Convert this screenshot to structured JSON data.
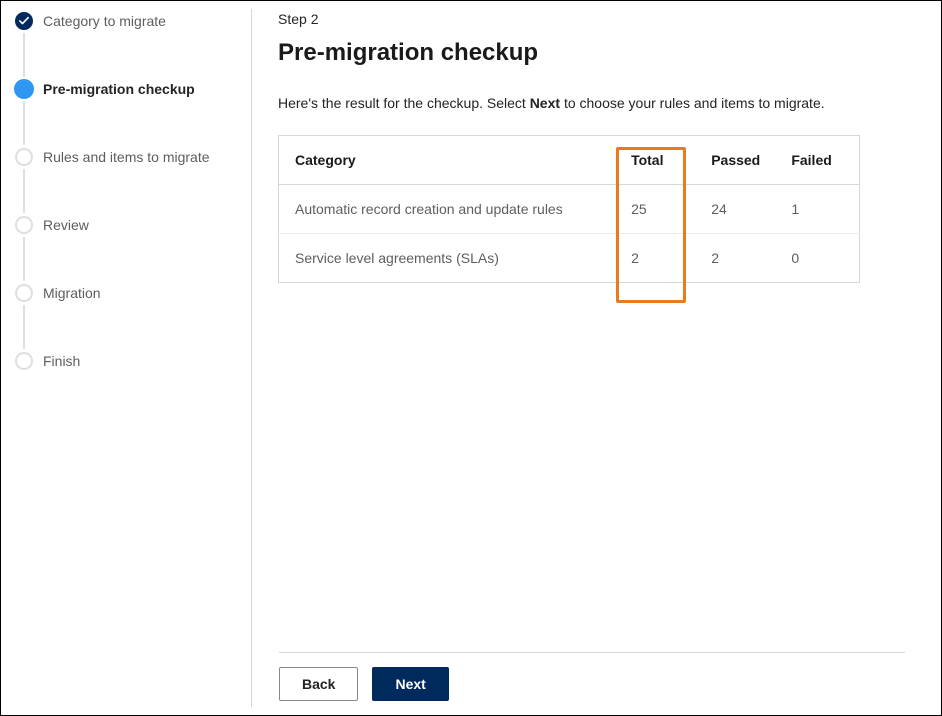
{
  "stepper": {
    "steps": [
      {
        "label": "Category to migrate",
        "state": "completed"
      },
      {
        "label": "Pre-migration checkup",
        "state": "current"
      },
      {
        "label": "Rules and items to migrate",
        "state": "future"
      },
      {
        "label": "Review",
        "state": "future"
      },
      {
        "label": "Migration",
        "state": "future"
      },
      {
        "label": "Finish",
        "state": "future"
      }
    ]
  },
  "main": {
    "step_indicator": "Step 2",
    "title": "Pre-migration checkup",
    "intro_before": "Here's the result for the checkup. Select ",
    "intro_strong": "Next",
    "intro_after": " to choose your rules and items to migrate."
  },
  "table": {
    "headers": {
      "category": "Category",
      "total": "Total",
      "passed": "Passed",
      "failed": "Failed"
    },
    "rows": [
      {
        "category": "Automatic record creation and update rules",
        "total": "25",
        "passed": "24",
        "failed": "1"
      },
      {
        "category": "Service level agreements (SLAs)",
        "total": "2",
        "passed": "2",
        "failed": "0"
      }
    ]
  },
  "footer": {
    "back": "Back",
    "next": "Next"
  },
  "chart_data": {
    "type": "table",
    "title": "Pre-migration checkup results",
    "columns": [
      "Category",
      "Total",
      "Passed",
      "Failed"
    ],
    "rows": [
      [
        "Automatic record creation and update rules",
        25,
        24,
        1
      ],
      [
        "Service level agreements (SLAs)",
        2,
        2,
        0
      ]
    ],
    "highlight_column": "Total"
  }
}
